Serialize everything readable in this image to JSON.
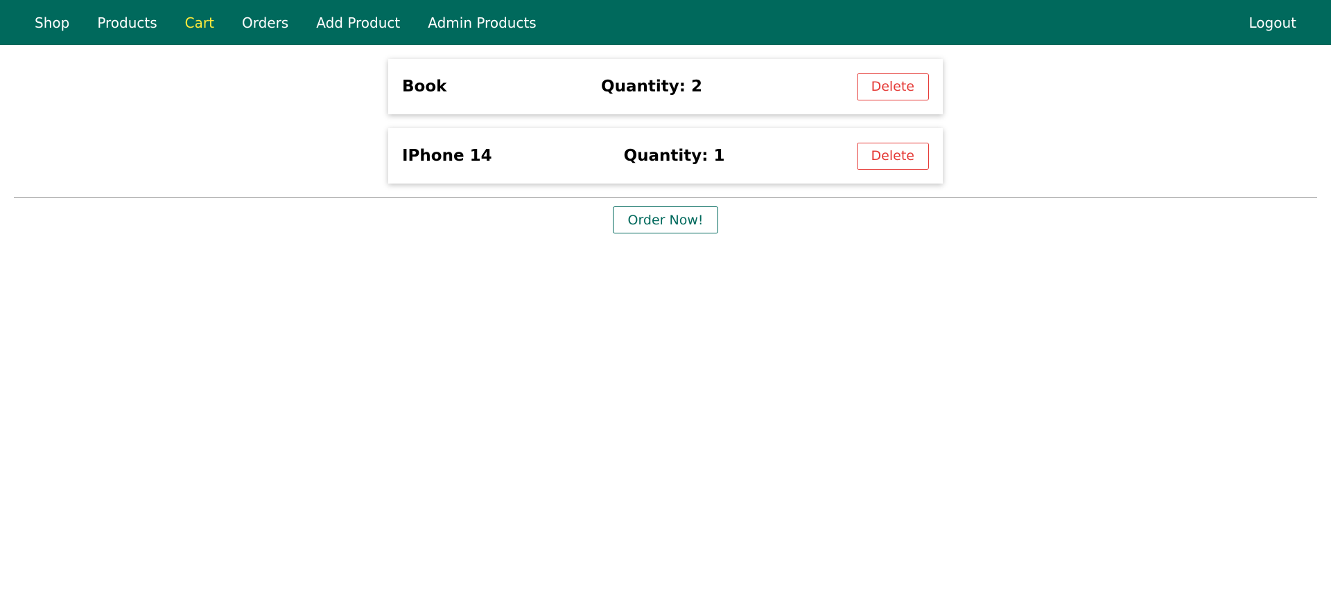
{
  "nav": {
    "items": [
      {
        "label": "Shop"
      },
      {
        "label": "Products"
      },
      {
        "label": "Cart"
      },
      {
        "label": "Orders"
      },
      {
        "label": "Add Product"
      },
      {
        "label": "Admin Products"
      }
    ],
    "active_item": "Cart",
    "logout_label": "Logout"
  },
  "cart": {
    "items": [
      {
        "title": "Book",
        "quantity_text": "Quantity: 2",
        "delete_label": "Delete"
      },
      {
        "title": "IPhone 14",
        "quantity_text": "Quantity: 1",
        "delete_label": "Delete"
      }
    ],
    "order_button_label": "Order Now!"
  },
  "colors": {
    "header_bg": "#00695c",
    "active_nav": "#ffeb3b",
    "delete": "#e53935",
    "order": "#00695c"
  }
}
